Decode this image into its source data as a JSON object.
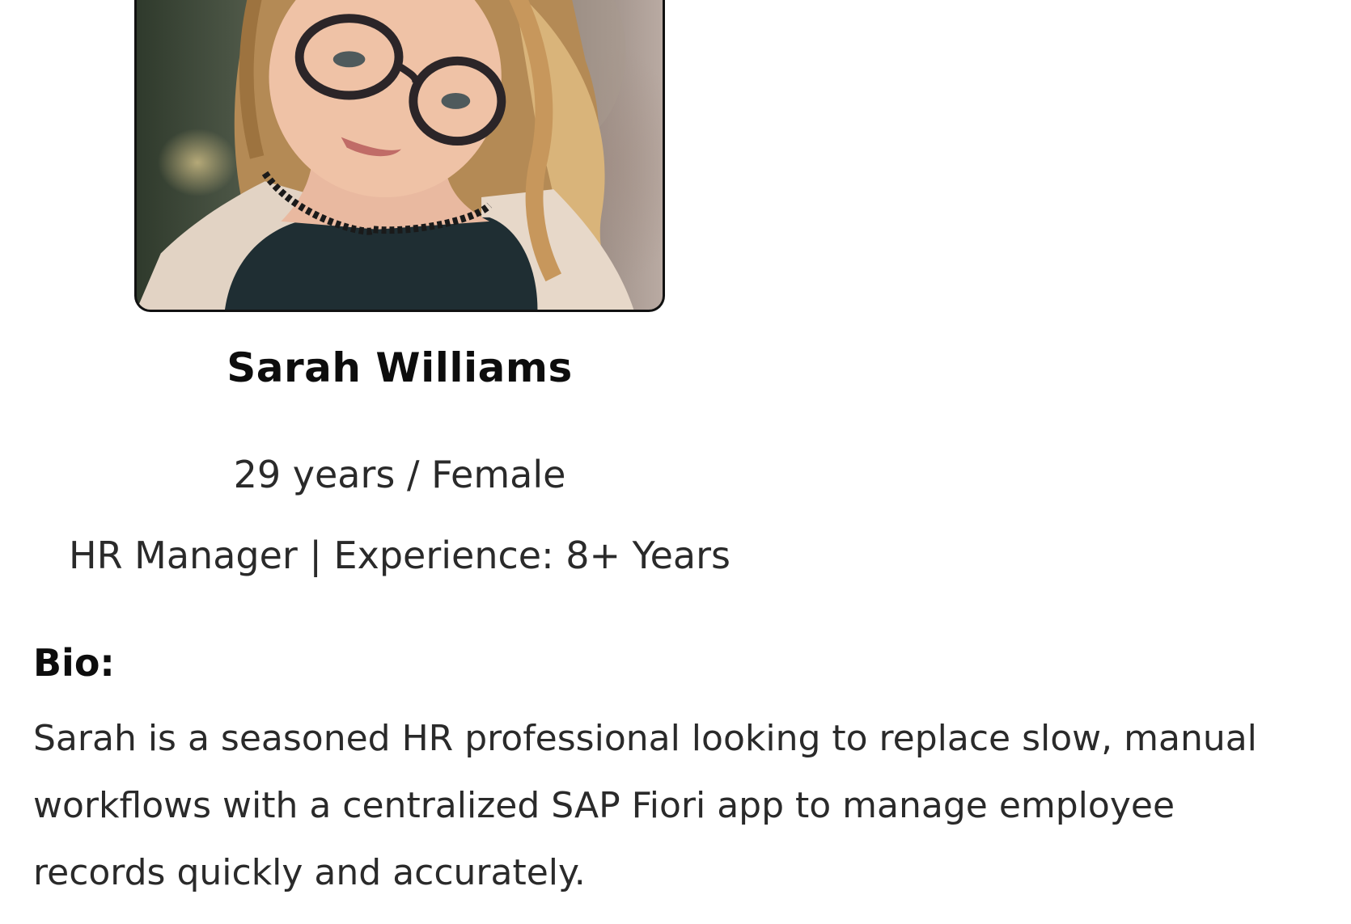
{
  "profile": {
    "name": "Sarah Williams",
    "age_gender": "29 years / Female",
    "role_experience": "HR Manager | Experience: 8+ Years"
  },
  "bio": {
    "label": "Bio:",
    "text": "Sarah is a seasoned HR professional looking to replace slow, manual workflows with a centralized SAP Fiori app to manage employee records quickly and accurately."
  },
  "colors": {
    "heading": "#0d0d0d",
    "body_text": "#2a2a2a",
    "photo_border": "#111111"
  }
}
